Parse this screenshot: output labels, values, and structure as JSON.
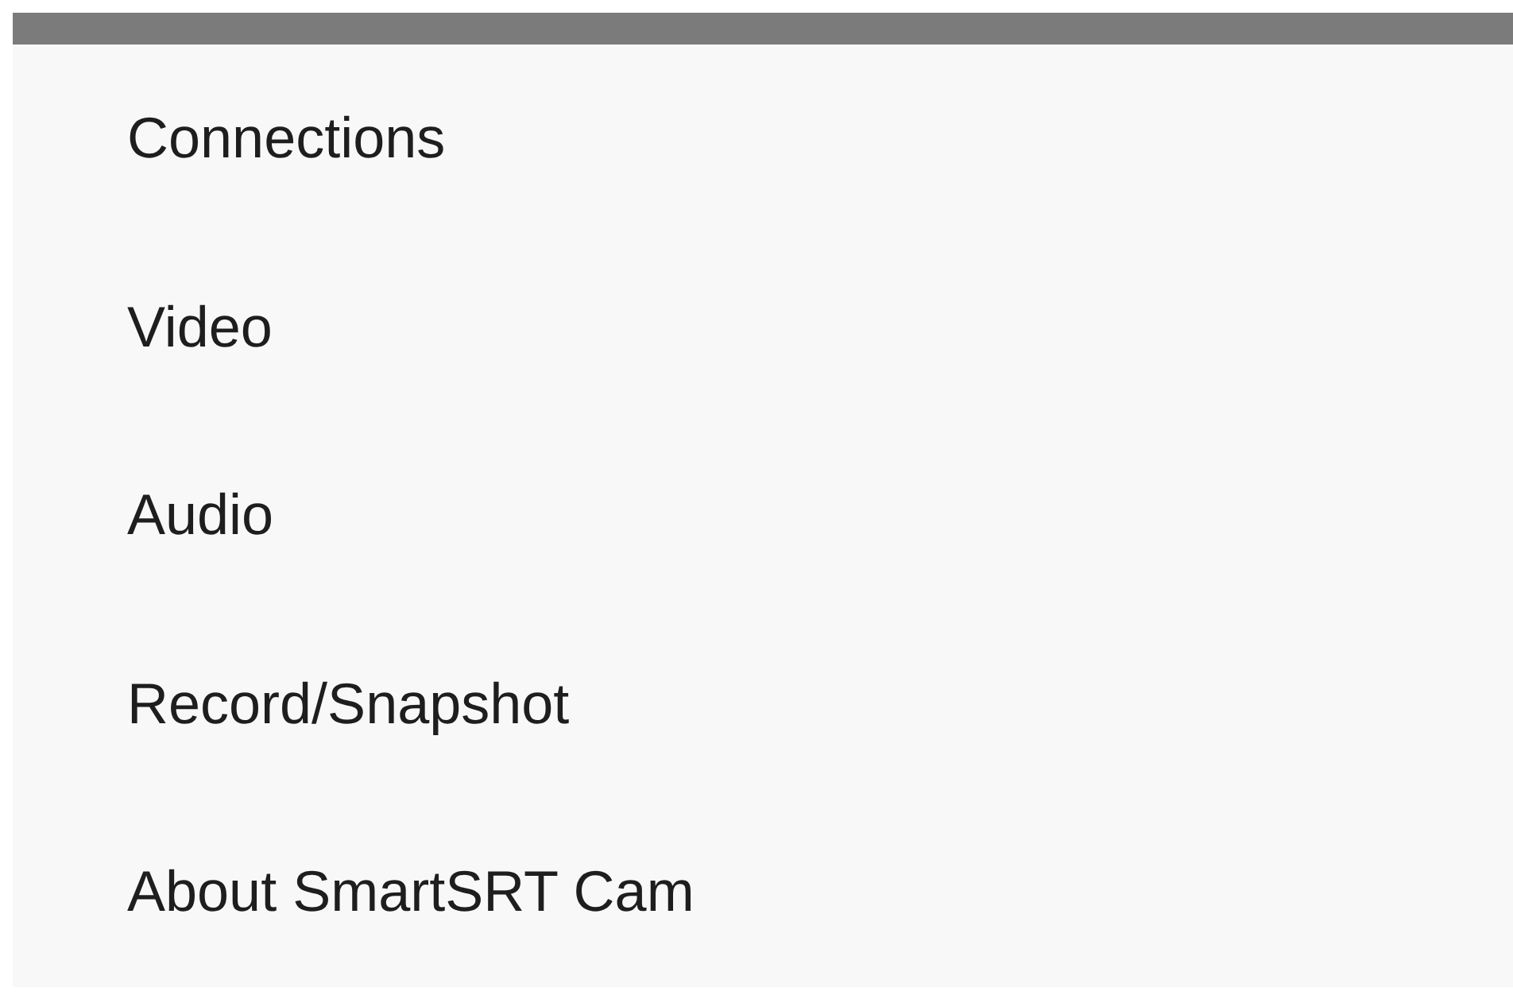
{
  "menu": {
    "items": [
      {
        "label": "Connections"
      },
      {
        "label": "Video"
      },
      {
        "label": "Audio"
      },
      {
        "label": "Record/Snapshot"
      },
      {
        "label": "About SmartSRT Cam"
      }
    ]
  }
}
